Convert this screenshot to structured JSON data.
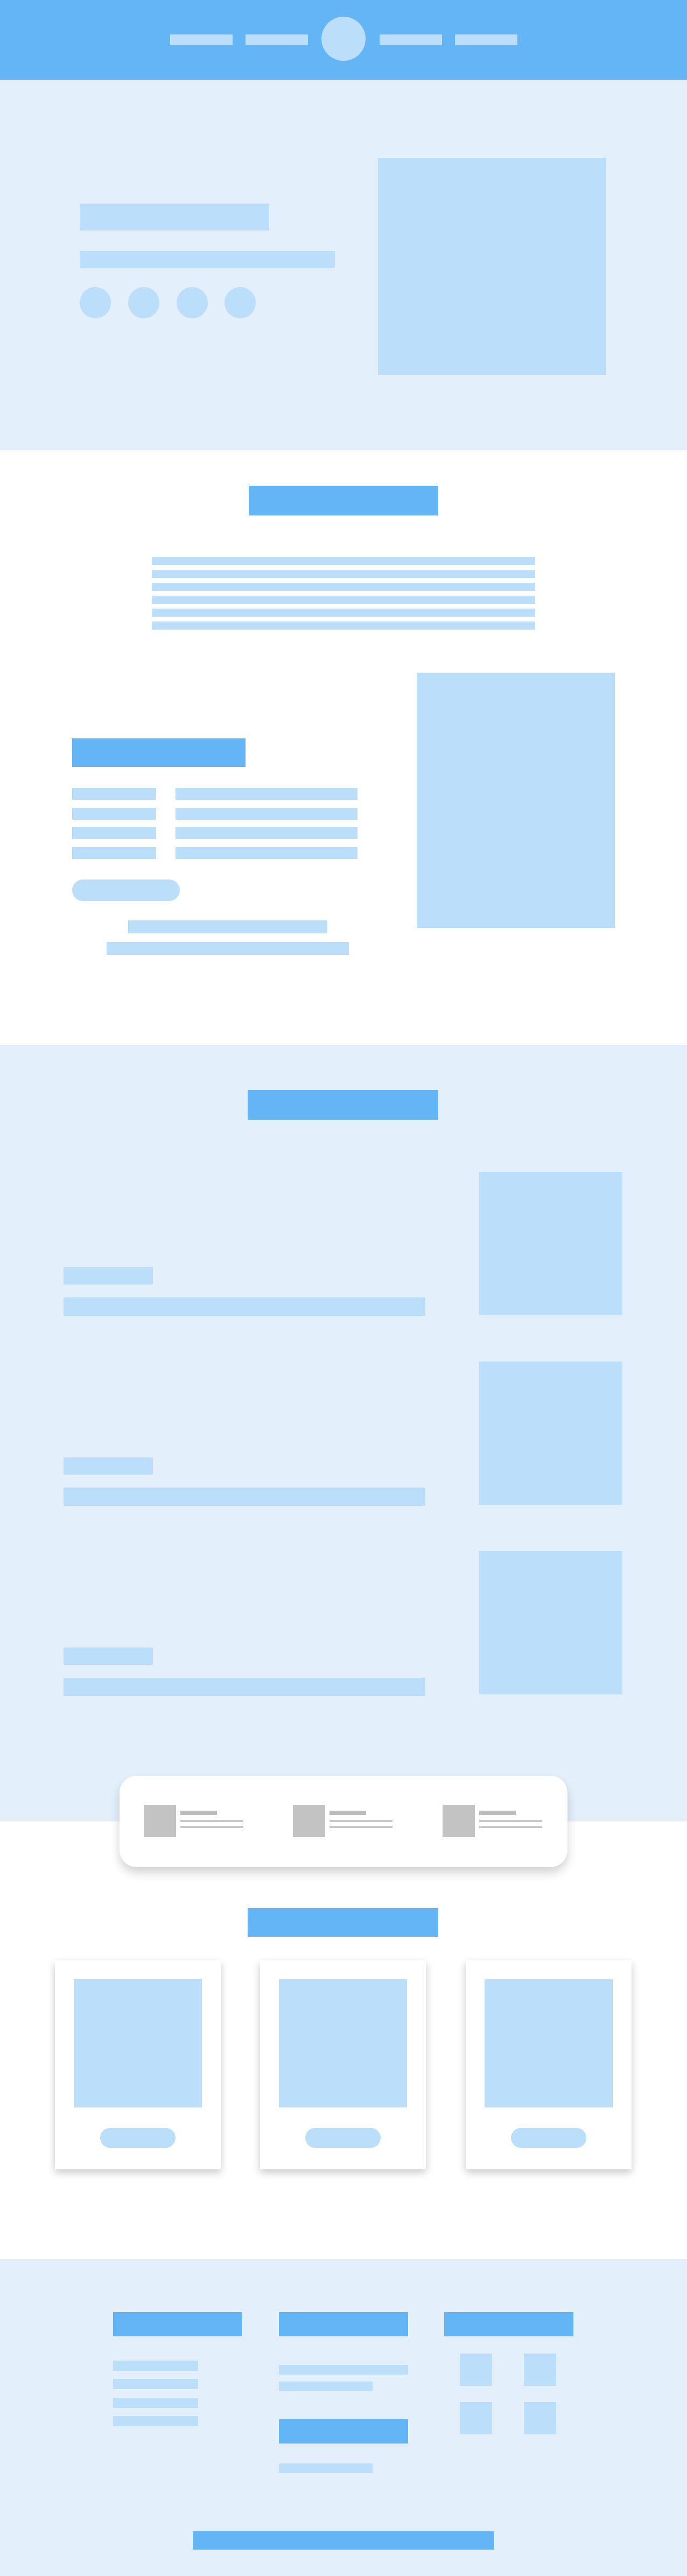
{
  "colors": {
    "accent": "#64b5f6",
    "light": "#bbdefb",
    "background": "#e3f0fc",
    "white": "#ffffff",
    "gray": "#c3c3c3"
  },
  "header": {
    "nav_left_items": [
      "",
      ""
    ],
    "logo_icon": "circle-logo",
    "nav_right_items": [
      "",
      ""
    ]
  },
  "hero": {
    "title": "",
    "subtitle": "",
    "social_icons": [
      "circle-icon",
      "circle-icon",
      "circle-icon",
      "circle-icon"
    ],
    "image_icon": "image-placeholder"
  },
  "about": {
    "heading": "",
    "paragraph_lines": [
      "",
      "",
      "",
      "",
      "",
      ""
    ],
    "details_heading": "",
    "details_rows": [
      {
        "label": "",
        "value": ""
      },
      {
        "label": "",
        "value": ""
      },
      {
        "label": "",
        "value": ""
      },
      {
        "label": "",
        "value": ""
      }
    ],
    "button_label": "",
    "footnote_lines": [
      "",
      ""
    ],
    "image_icon": "image-placeholder"
  },
  "features": {
    "heading": "",
    "items": [
      {
        "label": "",
        "text": "",
        "image_icon": "image-placeholder"
      },
      {
        "label": "",
        "text": "",
        "image_icon": "image-placeholder"
      },
      {
        "label": "",
        "text": "",
        "image_icon": "image-placeholder"
      }
    ]
  },
  "strip": {
    "items": [
      {
        "icon": "square-icon",
        "title": "",
        "line1": "",
        "line2": ""
      },
      {
        "icon": "square-icon",
        "title": "",
        "line1": "",
        "line2": ""
      },
      {
        "icon": "square-icon",
        "title": "",
        "line1": "",
        "line2": ""
      }
    ]
  },
  "cards": {
    "heading": "",
    "items": [
      {
        "image_icon": "image-placeholder",
        "button_label": ""
      },
      {
        "image_icon": "image-placeholder",
        "button_label": ""
      },
      {
        "image_icon": "image-placeholder",
        "button_label": ""
      }
    ]
  },
  "footer": {
    "col1": {
      "heading": "",
      "links": [
        "",
        "",
        "",
        ""
      ]
    },
    "col2": {
      "heading": "",
      "lines": [
        "",
        ""
      ],
      "heading2": "",
      "line3": ""
    },
    "col3": {
      "heading": "",
      "icons": [
        "square-icon",
        "square-icon",
        "square-icon",
        "square-icon"
      ]
    },
    "bottom_bar": ""
  }
}
